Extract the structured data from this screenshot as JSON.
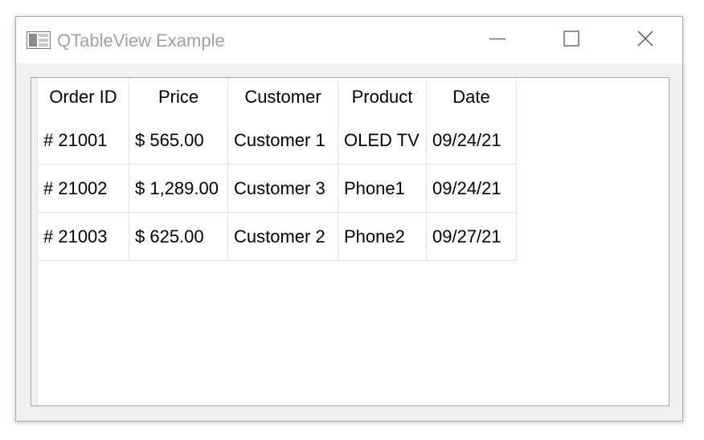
{
  "window": {
    "title": "QTableView Example",
    "icons": {
      "app": "app-window-icon",
      "minimize": "minimize-icon",
      "maximize": "maximize-icon",
      "close": "close-icon"
    }
  },
  "table": {
    "headers": [
      "Order ID",
      "Price",
      "Customer",
      "Product",
      "Date"
    ],
    "rows": [
      [
        "# 21001",
        "$ 565.00",
        "Customer 1",
        "OLED TV",
        "09/24/21"
      ],
      [
        "# 21002",
        "$ 1,289.00",
        "Customer 3",
        "Phone1",
        "09/24/21"
      ],
      [
        "# 21003",
        "$ 625.00",
        "Customer 2",
        "Phone2",
        "09/27/21"
      ]
    ]
  },
  "colors": {
    "title_text": "#a0a0a0",
    "grid_line": "#e3e3e3",
    "window_bg": "#f0f0f0"
  }
}
